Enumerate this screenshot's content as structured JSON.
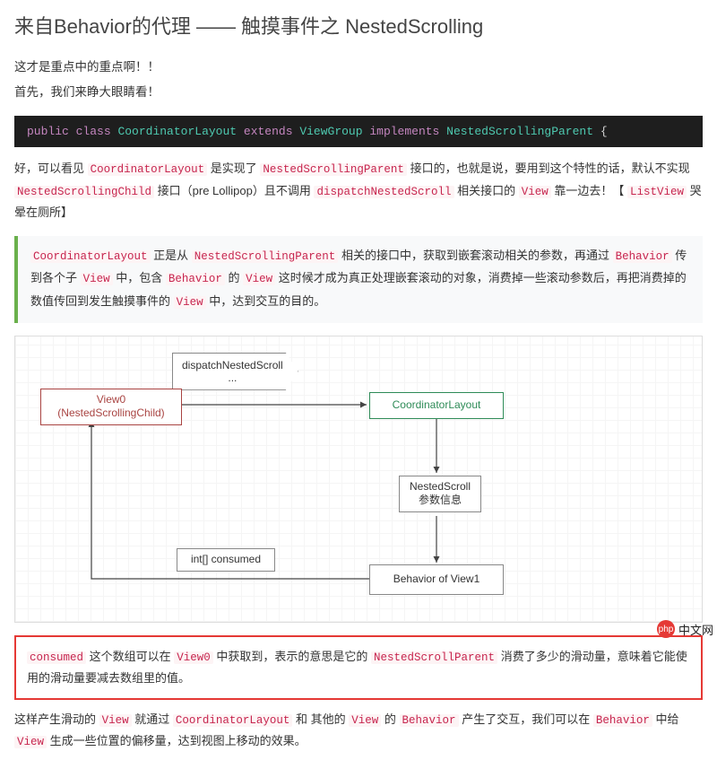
{
  "title": "来自Behavior的代理 —— 触摸事件之 NestedScrolling",
  "intro": [
    "这才是重点中的重点啊！！",
    "首先，我们来睁大眼睛看！"
  ],
  "code": {
    "kw_public": "public",
    "kw_class": "class",
    "name": "CoordinatorLayout",
    "kw_extends": "extends",
    "sup": "ViewGroup",
    "kw_implements": "implements",
    "iface": "NestedScrollingParent",
    "brace": "{"
  },
  "p1": {
    "a": "好，可以看见 ",
    "c1": "CoordinatorLayout",
    "b": " 是实现了 ",
    "c2": "NestedScrollingParent",
    "c": " 接口的，也就是说，要用到这个特性的话，默认不实现 ",
    "c3": "NestedScrollingChild",
    "d": " 接口（pre Lollipop）且不调用 ",
    "c4": "dispatchNestedScroll",
    "e": " 相关接口的 ",
    "c5": "View",
    "f": " 靠一边去！【 ",
    "c6": "ListView",
    "g": " 哭晕在厕所】"
  },
  "quote": {
    "c1": "CoordinatorLayout",
    "a": " 正是从 ",
    "c2": "NestedScrollingParent",
    "b": " 相关的接口中，获取到嵌套滚动相关的参数，再通过 ",
    "c3": "Behavior",
    "c": " 传到各个子 ",
    "c4": "View",
    "d": " 中，包含 ",
    "c5": "Behavior",
    "e": " 的 ",
    "c6": "View",
    "f": " 这时候才成为真正处理嵌套滚动的对象，消费掉一些滚动参数后，再把消费掉的数值传回到发生触摸事件的 ",
    "c7": "View",
    "g": " 中，达到交互的目的。"
  },
  "diagram": {
    "dispatch": "dispatchNestedScroll\n...",
    "view0_line1": "View0",
    "view0_line2": "(NestedScrollingChild)",
    "coordinator": "CoordinatorLayout",
    "nested_scroll_line1": "NestedScroll",
    "nested_scroll_line2": "参数信息",
    "consumed": "int[] consumed",
    "behavior": "Behavior of View1"
  },
  "callout": {
    "c1": "consumed",
    "a": " 这个数组可以在 ",
    "c2": "View0",
    "b": " 中获取到，表示的意思是它的 ",
    "c3": "NestedScrollParent",
    "c": " 消费了多少的滑动量，意味着它能使用的滑动量要减去数组里的值。"
  },
  "p2": {
    "a": "这样产生滑动的 ",
    "c1": "View",
    "b": " 就通过 ",
    "c2": "CoordinatorLayout",
    "c": " 和 其他的 ",
    "c3": "View",
    "d": " 的 ",
    "c4": "Behavior",
    "e": " 产生了交互，我们可以在 ",
    "c5": "Behavior",
    "f": " 中给 ",
    "c6": "View",
    "g": " 生成一些位置的偏移量，达到视图上移动的效果。"
  },
  "badge": {
    "icon": "php",
    "text": "中文网"
  }
}
